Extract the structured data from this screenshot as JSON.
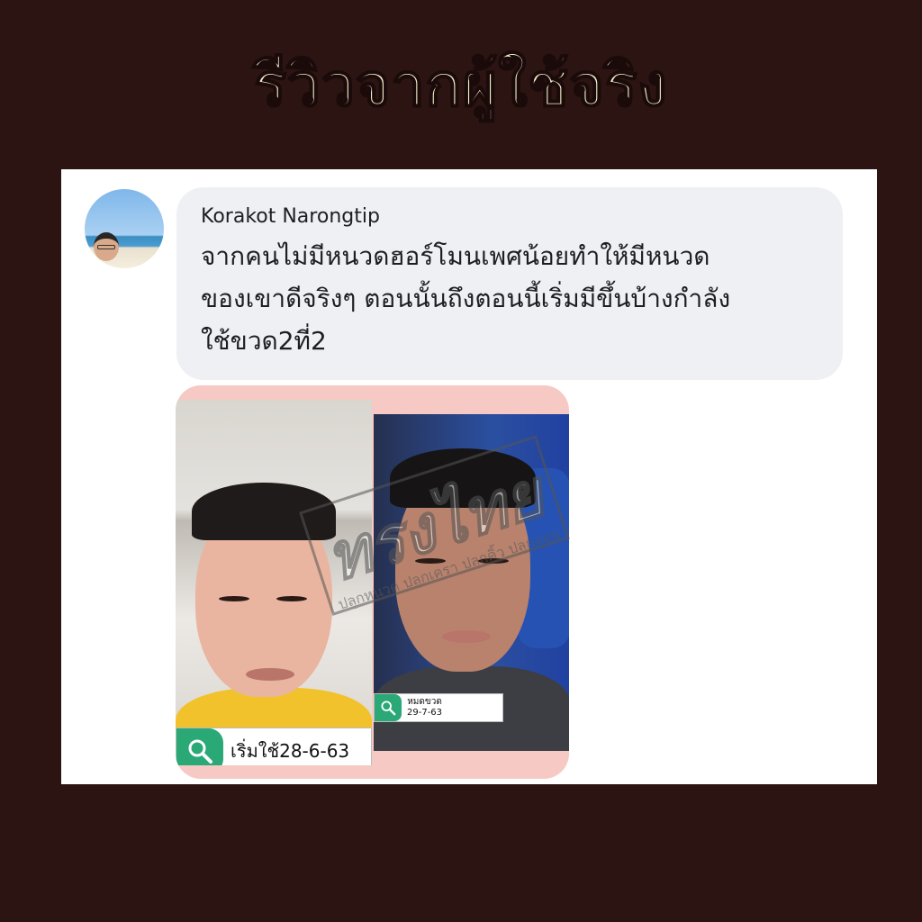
{
  "header": {
    "title": "รีวิวจากผู้ใช้จริง"
  },
  "comment": {
    "author": "Korakot Narongtip",
    "text": "จากคนไม่มีหนวดฮอร์โมนเพศน้อยทำให้มีหนวด\nของเขาดีจริงๆ ตอนนั้นถึงตอนนี้เริ่มมีขึ้นบ้างกำลัง\nใช้ขวด2ที่2"
  },
  "photos": {
    "before_label": "เริ่มใช้28-6-63",
    "after_label_line1": "หมดขวด",
    "after_label_line2": "29-7-63"
  },
  "watermark": {
    "brand": "ทรงไทย",
    "tagline": "ปลูกหนวด ปลูกเครา ปลูกคิ้ว ปลูกจอน"
  },
  "colors": {
    "background": "#2b1412",
    "title": "#f8f3cf",
    "bubble": "#eef0f3",
    "tag_green": "#2aa876",
    "photo_frame": "#f6c9c4"
  },
  "icons": [
    "search-icon",
    "search-icon"
  ]
}
